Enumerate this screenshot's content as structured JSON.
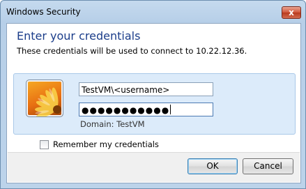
{
  "window": {
    "title": "Windows Security",
    "close_glyph": "x"
  },
  "dialog": {
    "heading": "Enter your credentials",
    "subtext": "These credentials will be used to connect to 10.22.12.36."
  },
  "credential_tile": {
    "avatar_icon": "user-tile-flower-icon",
    "username_value": "TestVM\\<username>",
    "password_mask": "●●●●●●●●●●●",
    "domain_label": "Domain: TestVM"
  },
  "remember": {
    "label": "Remember my credentials",
    "checked": false
  },
  "buttons": {
    "ok_label": "OK",
    "cancel_label": "Cancel"
  },
  "colors": {
    "heading": "#1b3d8a",
    "tile_bg": "#dcebfa",
    "accent_border": "#3c7fb1"
  }
}
